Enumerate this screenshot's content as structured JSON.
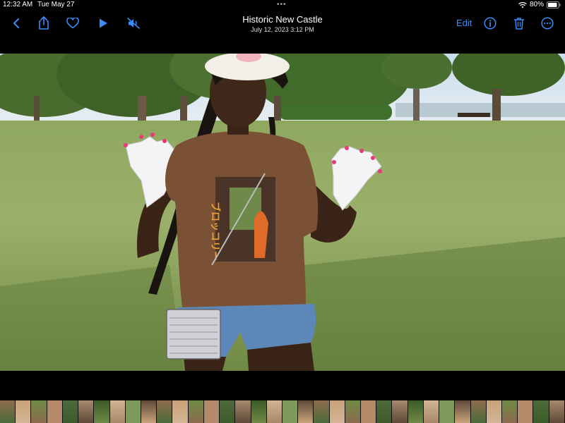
{
  "status_bar": {
    "time": "12:32 AM",
    "date": "Tue May 27",
    "battery": "80%",
    "icons": [
      "wifi-icon",
      "battery-icon"
    ]
  },
  "toolbar": {
    "title": "Historic New Castle",
    "subtitle": "July 12, 2023  3:12 PM",
    "edit_label": "Edit",
    "accent_color": "#3b8cf6",
    "icons": [
      "back-icon",
      "share-icon",
      "heart-icon",
      "play-icon",
      "mute-icon",
      "info-icon",
      "trash-icon",
      "more-icon"
    ]
  },
  "photo": {
    "subject": "person in brown t-shirt and white gloves in a park"
  },
  "filmstrip": {
    "thumbnail_count": 36
  }
}
